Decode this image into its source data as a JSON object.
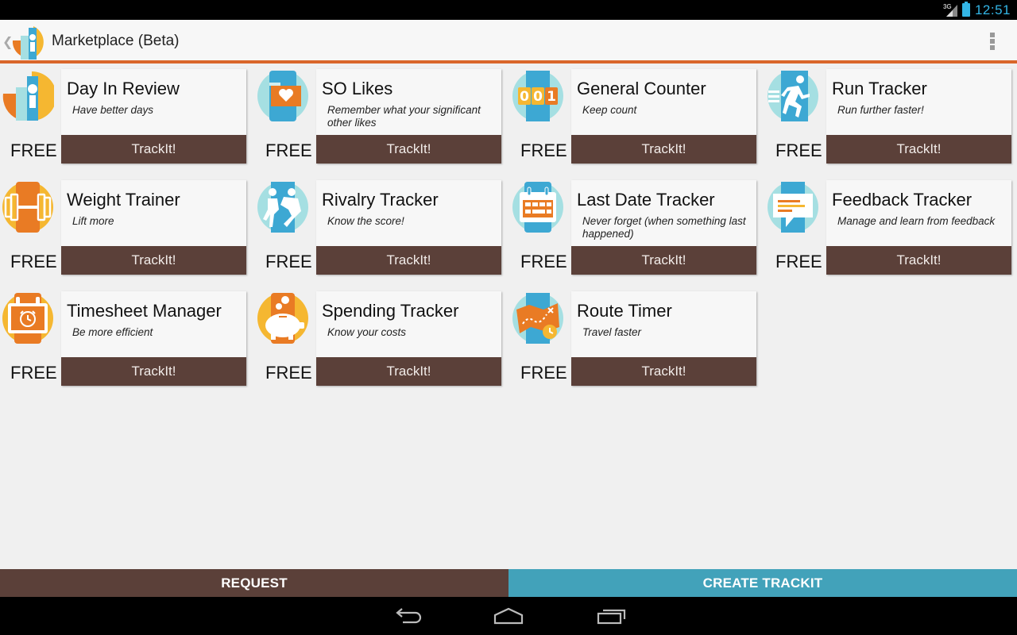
{
  "status_bar": {
    "network": "3G",
    "time": "12:51",
    "colors": {
      "accent": "#33b5e5"
    }
  },
  "action_bar": {
    "title": "Marketplace (Beta)",
    "accent_color": "#d9662a",
    "overflow_icon": "overflow-menu-icon",
    "up_icon": "chevron-left-icon"
  },
  "price_label": "FREE",
  "button_label": "TrackIt!",
  "trackers": [
    {
      "name": "Day In Review",
      "description": "Have better days",
      "price": "FREE",
      "button": "TrackIt!",
      "icon": "day-in-review-icon"
    },
    {
      "name": "SO Likes",
      "description": "Remember what your significant other likes",
      "price": "FREE",
      "button": "TrackIt!",
      "icon": "heart-card-icon"
    },
    {
      "name": "General Counter",
      "description": "Keep count",
      "price": "FREE",
      "button": "TrackIt!",
      "icon": "counter-icon",
      "icon_digits": [
        "0",
        "0",
        "1"
      ]
    },
    {
      "name": "Run Tracker",
      "description": "Run further faster!",
      "price": "FREE",
      "button": "TrackIt!",
      "icon": "runner-icon"
    },
    {
      "name": "Weight Trainer",
      "description": "Lift more",
      "price": "FREE",
      "button": "TrackIt!",
      "icon": "dumbbell-icon"
    },
    {
      "name": "Rivalry Tracker",
      "description": "Know the score!",
      "price": "FREE",
      "button": "TrackIt!",
      "icon": "rivalry-icon"
    },
    {
      "name": "Last Date Tracker",
      "description": "Never forget (when something last happened)",
      "price": "FREE",
      "button": "TrackIt!",
      "icon": "calendar-icon"
    },
    {
      "name": "Feedback Tracker",
      "description": "Manage and learn from feedback",
      "price": "FREE",
      "button": "TrackIt!",
      "icon": "speech-bubble-icon"
    },
    {
      "name": "Timesheet Manager",
      "description": "Be more efficient",
      "price": "FREE",
      "button": "TrackIt!",
      "icon": "alarm-clock-icon"
    },
    {
      "name": "Spending Tracker",
      "description": "Know your costs",
      "price": "FREE",
      "button": "TrackIt!",
      "icon": "piggy-bank-icon"
    },
    {
      "name": "Route Timer",
      "description": "Travel faster",
      "price": "FREE",
      "button": "TrackIt!",
      "icon": "map-route-icon"
    }
  ],
  "bottom_bar": {
    "request_label": "REQUEST",
    "create_label": "CREATE TRACKIT",
    "request_color": "#5b4039",
    "create_color": "#42a2ba"
  },
  "nav_bar": {
    "back_icon": "back-icon",
    "home_icon": "home-icon",
    "recents_icon": "recent-apps-icon"
  },
  "colors": {
    "button_brown": "#5b4039",
    "orange": "#e97b24",
    "yellow": "#f5b731",
    "teal_light": "#a5dfe2",
    "blue": "#3da8d3"
  }
}
